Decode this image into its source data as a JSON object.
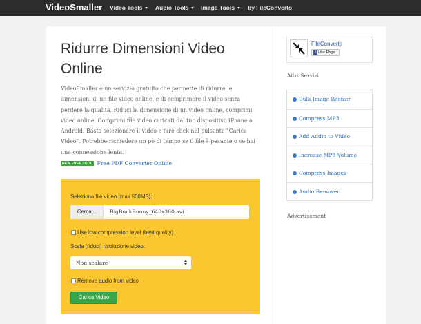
{
  "navbar": {
    "brand": "VideoSmaller",
    "items": [
      {
        "label": "Video Tools",
        "dropdown": true
      },
      {
        "label": "Audio Tools",
        "dropdown": true
      },
      {
        "label": "Image Tools",
        "dropdown": true
      },
      {
        "label": "by FileConverto",
        "dropdown": false
      }
    ]
  },
  "main": {
    "title": "Ridurre Dimensioni Video Online",
    "intro": "VideoSmaller è un servizio gratuito che permette di ridurre le dimensioni di un file video online, e di comprimere il video senza perdere la qualità. Riduci la dimensione di un video online, comprimi video online. Comprimi file video caricati dal tuo dispositivo iPhone o Android. Basta selezionare il video e fare click nel pulsante \"Carica Video\". Potrebbe richiedere un pò di tempo se il file è pesante o se hai una connessione lenta.",
    "new_tool_badge": "NEW FREE TOOL",
    "new_tool_link": "Free PDF Converter Online"
  },
  "form": {
    "file_label": "Seleziona file video (max 500MB):",
    "browse_label": "Cerca...",
    "file_value": "BigBuckBunny_640x360.avi",
    "low_compression_label": "Use low compression level (best quality)",
    "low_compression_checked": false,
    "scale_label": "Scala (riduci) risoluzione video:",
    "scale_value": "Non scalare",
    "remove_audio_label": "Remove audio from video",
    "remove_audio_checked": false,
    "submit_label": "Carica Video"
  },
  "sidebar": {
    "fb_page_name": "FileConverto",
    "fb_like_label": "Like Page",
    "services_heading": "Altri Servizi",
    "services": [
      {
        "label": "Bulk Image Resizer"
      },
      {
        "label": "Compress MP3"
      },
      {
        "label": "Add Audio to Video"
      },
      {
        "label": "Increase MP3 Volume"
      },
      {
        "label": "Compress Images"
      },
      {
        "label": "Audio Remover"
      }
    ],
    "advertisement_label": "Advertisement"
  },
  "colors": {
    "navbar_bg": "#2d2d2d",
    "form_bg": "#fbc730",
    "submit_bg": "#3aa84a",
    "link": "#2a6fb8",
    "facebook": "#3b5998"
  }
}
